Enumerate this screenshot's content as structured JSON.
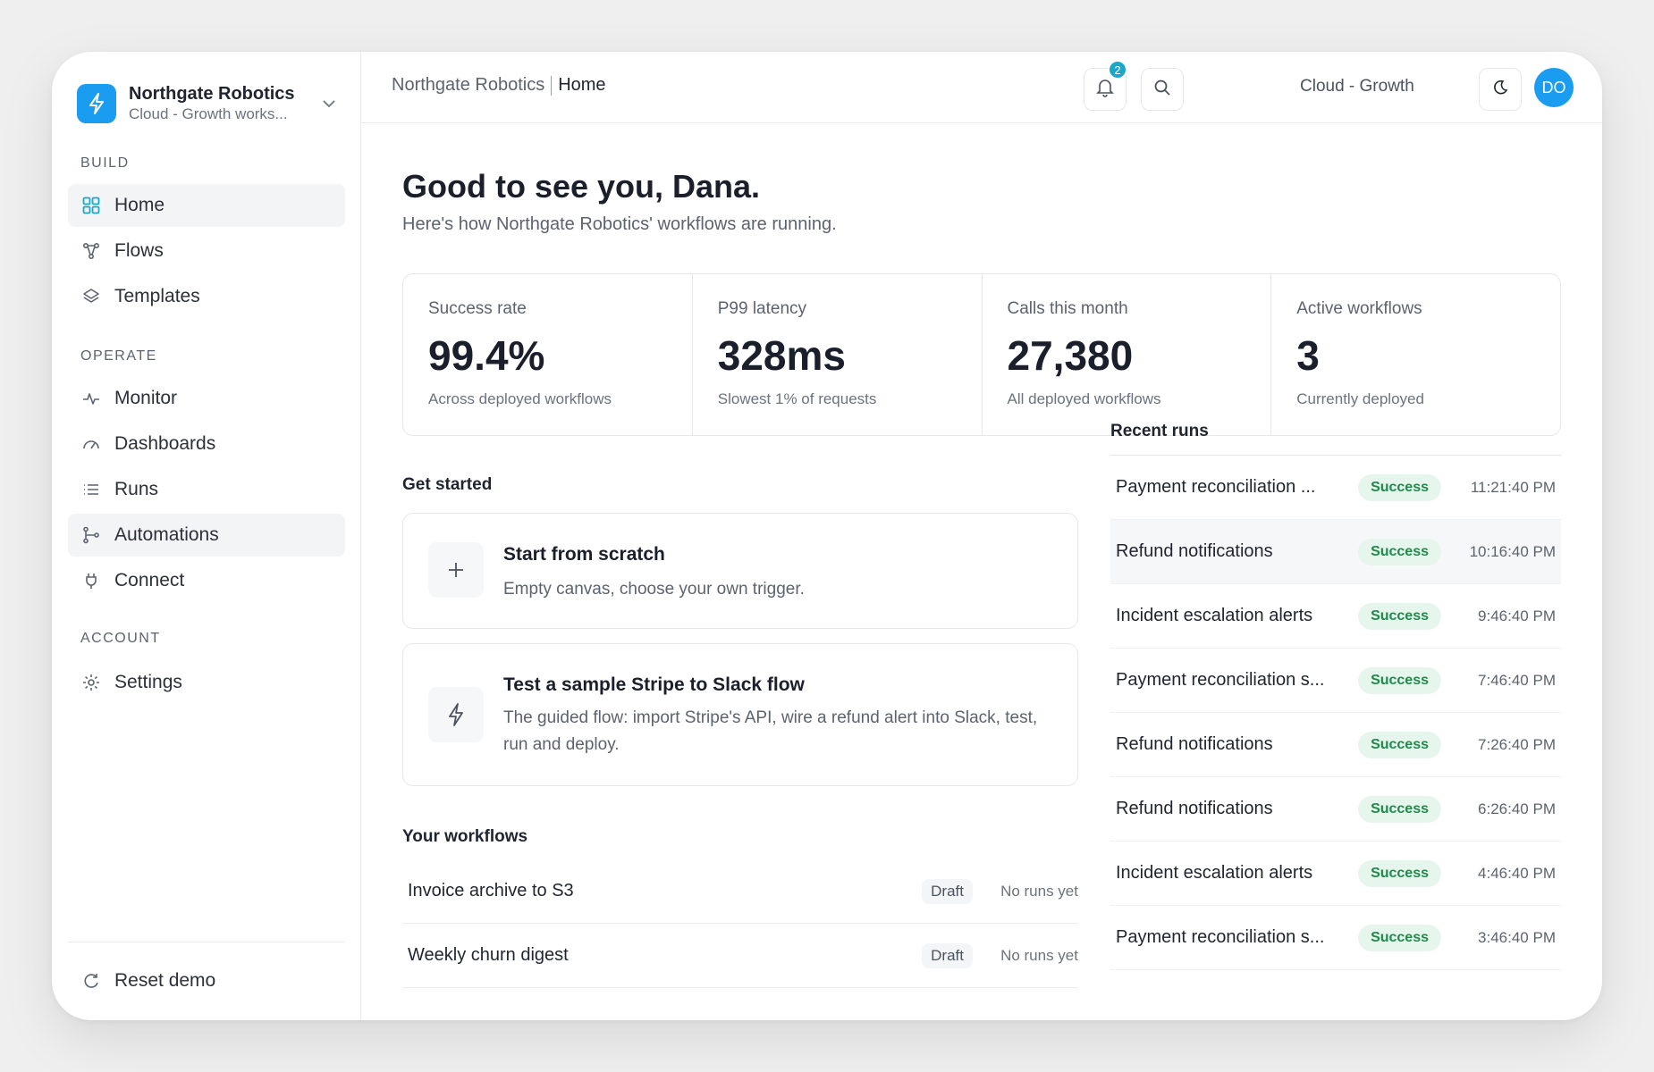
{
  "workspace": {
    "name": "Northgate Robotics",
    "subtitle": "Cloud - Growth works..."
  },
  "sidebar": {
    "build_label": "BUILD",
    "operate_label": "OPERATE",
    "account_label": "ACCOUNT",
    "build_items": [
      {
        "label": "Home",
        "icon": "grid-icon"
      },
      {
        "label": "Flows",
        "icon": "flow-icon"
      },
      {
        "label": "Templates",
        "icon": "layers-icon"
      }
    ],
    "operate_items": [
      {
        "label": "Monitor",
        "icon": "pulse-icon"
      },
      {
        "label": "Dashboards",
        "icon": "gauge-icon"
      },
      {
        "label": "Runs",
        "icon": "list-icon"
      },
      {
        "label": "Automations",
        "icon": "branch-icon"
      },
      {
        "label": "Connect",
        "icon": "plug-icon"
      }
    ],
    "account_items": [
      {
        "label": "Settings",
        "icon": "gear-icon"
      }
    ],
    "reset_label": "Reset demo"
  },
  "topbar": {
    "breadcrumb_org": "Northgate Robotics",
    "breadcrumb_current": "Home",
    "notification_count": "2",
    "plan_label": "Cloud - Growth",
    "avatar_initials": "DO"
  },
  "greeting": {
    "title": "Good to see you, Dana.",
    "subtitle": "Here's how Northgate Robotics' workflows are running."
  },
  "stats": [
    {
      "label": "Success rate",
      "value": "99.4%",
      "note": "Across deployed workflows"
    },
    {
      "label": "P99 latency",
      "value": "328ms",
      "note": "Slowest 1% of requests"
    },
    {
      "label": "Calls this month",
      "value": "27,380",
      "note": "All deployed workflows"
    },
    {
      "label": "Active workflows",
      "value": "3",
      "note": "Currently deployed"
    }
  ],
  "get_started": {
    "heading": "Get started",
    "cards": [
      {
        "title": "Start from scratch",
        "desc": "Empty canvas, choose your own trigger.",
        "icon": "plus-icon"
      },
      {
        "title": "Test a sample Stripe to Slack flow",
        "desc": "The guided flow: import Stripe's API, wire a refund alert into Slack, test, run and deploy.",
        "icon": "bolt-icon"
      }
    ]
  },
  "workflows": {
    "heading": "Your workflows",
    "rows": [
      {
        "name": "Invoice archive to S3",
        "status": "Draft",
        "runs": "No runs yet"
      },
      {
        "name": "Weekly churn digest",
        "status": "Draft",
        "runs": "No runs yet"
      }
    ]
  },
  "recent_runs": {
    "heading": "Recent runs",
    "rows": [
      {
        "name": "Payment reconciliation ...",
        "status": "Success",
        "time": "11:21:40 PM"
      },
      {
        "name": "Refund notifications",
        "status": "Success",
        "time": "10:16:40 PM"
      },
      {
        "name": "Incident escalation alerts",
        "status": "Success",
        "time": "9:46:40 PM"
      },
      {
        "name": "Payment reconciliation s...",
        "status": "Success",
        "time": "7:46:40 PM"
      },
      {
        "name": "Refund notifications",
        "status": "Success",
        "time": "7:26:40 PM"
      },
      {
        "name": "Refund notifications",
        "status": "Success",
        "time": "6:26:40 PM"
      },
      {
        "name": "Incident escalation alerts",
        "status": "Success",
        "time": "4:46:40 PM"
      },
      {
        "name": "Payment reconciliation s...",
        "status": "Success",
        "time": "3:46:40 PM"
      }
    ]
  },
  "colors": {
    "accent": "#1a9cf0",
    "success_text": "#1f8a4c",
    "success_bg": "#e6f6ec",
    "badge": "#1aa7c8"
  }
}
